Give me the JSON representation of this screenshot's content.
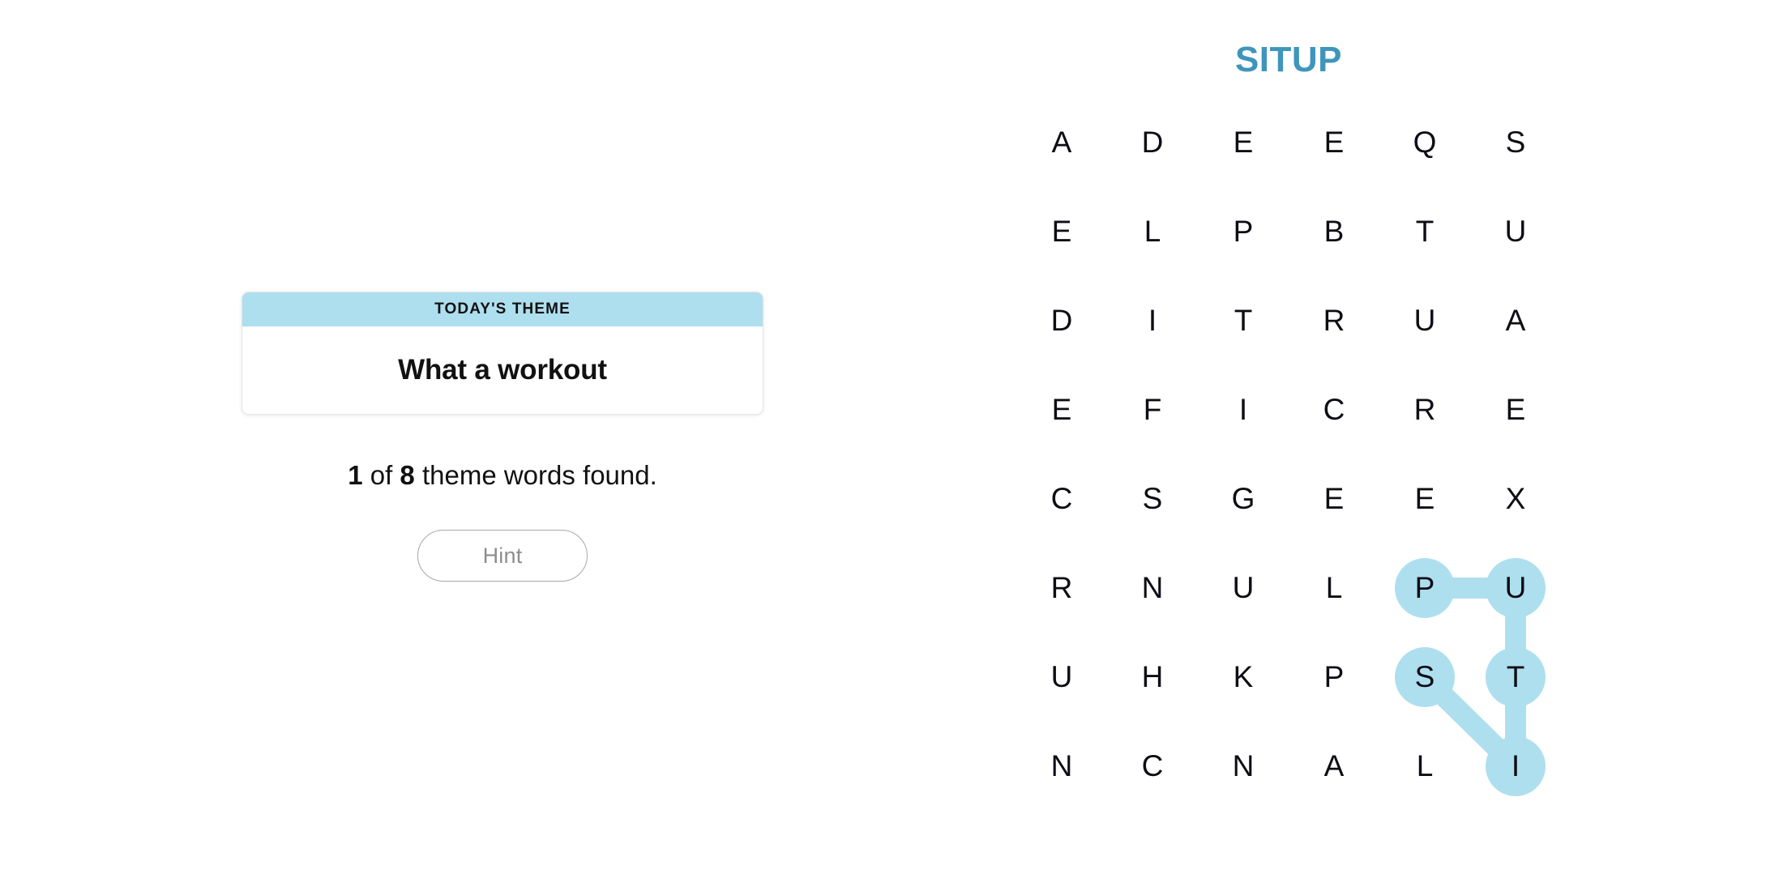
{
  "puzzle": {
    "title": "SITUP",
    "title_color": "#3f95bb",
    "highlight_color": "#aedfee",
    "columns": 6,
    "rows": 8,
    "grid": [
      [
        "A",
        "D",
        "E",
        "E",
        "Q",
        "S"
      ],
      [
        "E",
        "L",
        "P",
        "B",
        "T",
        "U"
      ],
      [
        "D",
        "I",
        "T",
        "R",
        "U",
        "A"
      ],
      [
        "E",
        "F",
        "I",
        "C",
        "R",
        "E"
      ],
      [
        "C",
        "S",
        "G",
        "E",
        "E",
        "X"
      ],
      [
        "R",
        "N",
        "U",
        "L",
        "P",
        "U"
      ],
      [
        "U",
        "H",
        "K",
        "P",
        "S",
        "T"
      ],
      [
        "N",
        "C",
        "N",
        "A",
        "L",
        "I"
      ]
    ],
    "found_word": {
      "word": "SITUP",
      "path": [
        {
          "row": 6,
          "col": 4,
          "letter": "S"
        },
        {
          "row": 7,
          "col": 5,
          "letter": "I"
        },
        {
          "row": 6,
          "col": 5,
          "letter": "T"
        },
        {
          "row": 5,
          "col": 5,
          "letter": "U"
        },
        {
          "row": 5,
          "col": 4,
          "letter": "P"
        }
      ]
    }
  },
  "theme_card": {
    "header_label": "TODAY'S THEME",
    "title": "What a workout",
    "header_bg": "#aedfee"
  },
  "progress": {
    "found_count": "1",
    "middle_text": " of ",
    "total_count": "8",
    "suffix_text": " theme words found."
  },
  "hint": {
    "label": "Hint"
  }
}
